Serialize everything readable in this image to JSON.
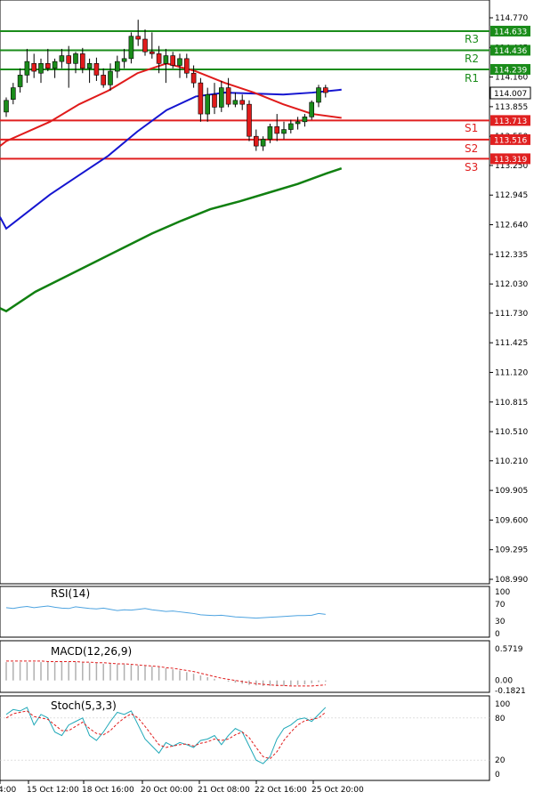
{
  "chart_data": {
    "type": "candlestick",
    "price_axis": {
      "ticks": [
        "114.770",
        "114.465",
        "114.160",
        "113.855",
        "113.550",
        "113.250",
        "112.945",
        "112.640",
        "112.335",
        "112.030",
        "111.730",
        "111.425",
        "111.120",
        "110.815",
        "110.510",
        "110.210",
        "109.905",
        "109.600",
        "109.295",
        "108.990"
      ]
    },
    "current_price": "114.007",
    "levels": [
      {
        "name": "R3",
        "value": "114.633",
        "color": "#1a8c1a"
      },
      {
        "name": "R2",
        "value": "114.436",
        "color": "#1a8c1a"
      },
      {
        "name": "R1",
        "value": "114.239",
        "color": "#1a8c1a"
      },
      {
        "name": "S1",
        "value": "113.713",
        "color": "#e02020"
      },
      {
        "name": "S2",
        "value": "113.516",
        "color": "#e02020"
      },
      {
        "name": "S3",
        "value": "113.319",
        "color": "#e02020"
      }
    ],
    "candles": [
      {
        "o": 113.8,
        "h": 113.95,
        "l": 113.75,
        "c": 113.92
      },
      {
        "o": 113.93,
        "h": 114.1,
        "l": 113.88,
        "c": 114.05
      },
      {
        "o": 114.06,
        "h": 114.25,
        "l": 114.0,
        "c": 114.18
      },
      {
        "o": 114.18,
        "h": 114.45,
        "l": 114.1,
        "c": 114.32
      },
      {
        "o": 114.3,
        "h": 114.4,
        "l": 114.15,
        "c": 114.22
      },
      {
        "o": 114.2,
        "h": 114.35,
        "l": 114.1,
        "c": 114.3
      },
      {
        "o": 114.3,
        "h": 114.45,
        "l": 114.22,
        "c": 114.25
      },
      {
        "o": 114.25,
        "h": 114.35,
        "l": 114.15,
        "c": 114.32
      },
      {
        "o": 114.32,
        "h": 114.45,
        "l": 114.25,
        "c": 114.38
      },
      {
        "o": 114.38,
        "h": 114.48,
        "l": 114.05,
        "c": 114.3
      },
      {
        "o": 114.3,
        "h": 114.42,
        "l": 114.2,
        "c": 114.4
      },
      {
        "o": 114.4,
        "h": 114.46,
        "l": 114.2,
        "c": 114.25
      },
      {
        "o": 114.25,
        "h": 114.35,
        "l": 114.1,
        "c": 114.3
      },
      {
        "o": 114.3,
        "h": 114.36,
        "l": 114.12,
        "c": 114.18
      },
      {
        "o": 114.18,
        "h": 114.25,
        "l": 114.05,
        "c": 114.08
      },
      {
        "o": 114.08,
        "h": 114.3,
        "l": 114.02,
        "c": 114.22
      },
      {
        "o": 114.22,
        "h": 114.38,
        "l": 114.15,
        "c": 114.32
      },
      {
        "o": 114.32,
        "h": 114.45,
        "l": 114.25,
        "c": 114.35
      },
      {
        "o": 114.35,
        "h": 114.62,
        "l": 114.3,
        "c": 114.58
      },
      {
        "o": 114.58,
        "h": 114.75,
        "l": 114.48,
        "c": 114.55
      },
      {
        "o": 114.55,
        "h": 114.65,
        "l": 114.38,
        "c": 114.42
      },
      {
        "o": 114.42,
        "h": 114.62,
        "l": 114.35,
        "c": 114.4
      },
      {
        "o": 114.4,
        "h": 114.48,
        "l": 114.2,
        "c": 114.3
      },
      {
        "o": 114.3,
        "h": 114.45,
        "l": 114.1,
        "c": 114.38
      },
      {
        "o": 114.38,
        "h": 114.42,
        "l": 114.25,
        "c": 114.28
      },
      {
        "o": 114.28,
        "h": 114.4,
        "l": 114.15,
        "c": 114.35
      },
      {
        "o": 114.35,
        "h": 114.4,
        "l": 114.15,
        "c": 114.2
      },
      {
        "o": 114.2,
        "h": 114.28,
        "l": 114.05,
        "c": 114.1
      },
      {
        "o": 114.1,
        "h": 114.15,
        "l": 113.7,
        "c": 113.78
      },
      {
        "o": 113.78,
        "h": 114.05,
        "l": 113.7,
        "c": 113.98
      },
      {
        "o": 113.98,
        "h": 114.1,
        "l": 113.78,
        "c": 113.85
      },
      {
        "o": 113.85,
        "h": 114.12,
        "l": 113.8,
        "c": 114.05
      },
      {
        "o": 114.05,
        "h": 114.15,
        "l": 113.85,
        "c": 113.88
      },
      {
        "o": 113.88,
        "h": 114.0,
        "l": 113.85,
        "c": 113.92
      },
      {
        "o": 113.92,
        "h": 113.98,
        "l": 113.82,
        "c": 113.88
      },
      {
        "o": 113.88,
        "h": 113.92,
        "l": 113.5,
        "c": 113.55
      },
      {
        "o": 113.55,
        "h": 113.62,
        "l": 113.4,
        "c": 113.45
      },
      {
        "o": 113.45,
        "h": 113.55,
        "l": 113.4,
        "c": 113.52
      },
      {
        "o": 113.52,
        "h": 113.68,
        "l": 113.48,
        "c": 113.65
      },
      {
        "o": 113.65,
        "h": 113.78,
        "l": 113.5,
        "c": 113.58
      },
      {
        "o": 113.58,
        "h": 113.7,
        "l": 113.52,
        "c": 113.62
      },
      {
        "o": 113.62,
        "h": 113.72,
        "l": 113.58,
        "c": 113.68
      },
      {
        "o": 113.68,
        "h": 113.75,
        "l": 113.62,
        "c": 113.7
      },
      {
        "o": 113.7,
        "h": 113.78,
        "l": 113.65,
        "c": 113.75
      },
      {
        "o": 113.75,
        "h": 113.92,
        "l": 113.72,
        "c": 113.9
      },
      {
        "o": 113.9,
        "h": 114.08,
        "l": 113.85,
        "c": 114.05
      },
      {
        "o": 114.05,
        "h": 114.08,
        "l": 113.95,
        "c": 114.0
      }
    ],
    "ma_fast": {
      "color": "#e01b1b",
      "points": [
        [
          0,
          113.5
        ],
        [
          6,
          113.7
        ],
        [
          10,
          113.88
        ],
        [
          14,
          114.02
        ],
        [
          18,
          114.2
        ],
        [
          22,
          114.3
        ],
        [
          26,
          114.22
        ],
        [
          30,
          114.1
        ],
        [
          34,
          114.0
        ],
        [
          38,
          113.88
        ],
        [
          42,
          113.78
        ],
        [
          46,
          113.74
        ]
      ]
    },
    "ma_mid": {
      "color": "#1515d0",
      "points": [
        [
          0,
          112.6
        ],
        [
          6,
          112.95
        ],
        [
          10,
          113.15
        ],
        [
          14,
          113.35
        ],
        [
          18,
          113.6
        ],
        [
          22,
          113.82
        ],
        [
          26,
          113.96
        ],
        [
          30,
          114.0
        ],
        [
          34,
          113.99
        ],
        [
          38,
          113.98
        ],
        [
          42,
          114.0
        ],
        [
          46,
          114.03
        ]
      ]
    },
    "ma_slow": {
      "color": "#118011",
      "points": [
        [
          0,
          111.75
        ],
        [
          4,
          111.95
        ],
        [
          8,
          112.1
        ],
        [
          12,
          112.25
        ],
        [
          16,
          112.4
        ],
        [
          20,
          112.55
        ],
        [
          24,
          112.68
        ],
        [
          28,
          112.8
        ],
        [
          32,
          112.88
        ],
        [
          36,
          112.97
        ],
        [
          40,
          113.06
        ],
        [
          44,
          113.17
        ],
        [
          46,
          113.22
        ]
      ]
    },
    "rsi": {
      "label": "RSI(14)",
      "ticks": [
        "100",
        "70",
        "30",
        "0"
      ],
      "values": [
        62,
        60,
        63,
        65,
        62,
        64,
        66,
        63,
        61,
        60,
        64,
        62,
        60,
        59,
        61,
        58,
        55,
        57,
        56,
        58,
        60,
        57,
        55,
        53,
        54,
        52,
        50,
        48,
        45,
        44,
        43,
        44,
        42,
        40,
        39,
        38,
        37,
        38,
        39,
        40,
        41,
        42,
        43,
        43,
        44,
        48,
        46
      ]
    },
    "macd": {
      "label": "MACD(12,26,9)",
      "ticks": [
        "0.5719",
        "0.00",
        "-0.1821"
      ],
      "histogram": [
        0.33,
        0.33,
        0.33,
        0.33,
        0.33,
        0.33,
        0.33,
        0.33,
        0.33,
        0.33,
        0.33,
        0.32,
        0.32,
        0.31,
        0.3,
        0.3,
        0.29,
        0.29,
        0.28,
        0.27,
        0.26,
        0.25,
        0.24,
        0.22,
        0.2,
        0.18,
        0.15,
        0.12,
        0.09,
        0.06,
        0.03,
        0.0,
        -0.02,
        -0.04,
        -0.06,
        -0.08,
        -0.09,
        -0.1,
        -0.1,
        -0.1,
        -0.1,
        -0.09,
        -0.08,
        -0.07,
        -0.05,
        -0.03,
        -0.02
      ],
      "signal": [
        0.35,
        0.35,
        0.35,
        0.35,
        0.35,
        0.35,
        0.34,
        0.34,
        0.34,
        0.34,
        0.34,
        0.33,
        0.33,
        0.32,
        0.32,
        0.31,
        0.3,
        0.3,
        0.29,
        0.28,
        0.27,
        0.26,
        0.25,
        0.23,
        0.22,
        0.2,
        0.18,
        0.16,
        0.13,
        0.1,
        0.07,
        0.04,
        0.02,
        0.0,
        -0.02,
        -0.04,
        -0.06,
        -0.07,
        -0.08,
        -0.09,
        -0.09,
        -0.1,
        -0.1,
        -0.1,
        -0.1,
        -0.09,
        -0.08
      ]
    },
    "stoch": {
      "label": "Stoch(5,3,3)",
      "ticks": [
        "100",
        "80",
        "20",
        "0"
      ],
      "main": [
        85,
        92,
        90,
        95,
        70,
        85,
        80,
        60,
        55,
        70,
        75,
        80,
        55,
        48,
        60,
        75,
        88,
        85,
        90,
        70,
        50,
        40,
        30,
        45,
        40,
        45,
        42,
        38,
        48,
        50,
        55,
        42,
        55,
        65,
        60,
        40,
        20,
        15,
        25,
        50,
        65,
        70,
        78,
        80,
        75,
        85,
        95
      ],
      "signal": [
        80,
        86,
        88,
        90,
        82,
        80,
        78,
        70,
        62,
        62,
        68,
        74,
        65,
        58,
        56,
        62,
        72,
        80,
        86,
        80,
        68,
        55,
        42,
        38,
        40,
        42,
        43,
        40,
        44,
        46,
        50,
        48,
        50,
        56,
        60,
        52,
        38,
        25,
        22,
        32,
        48,
        60,
        70,
        76,
        78,
        80,
        88
      ]
    },
    "x_ticks": [
      "4:00",
      "15 Oct 12:00",
      "18 Oct 16:00",
      "20 Oct 00:00",
      "21 Oct 08:00",
      "22 Oct 16:00",
      "25 Oct 20:00"
    ]
  }
}
